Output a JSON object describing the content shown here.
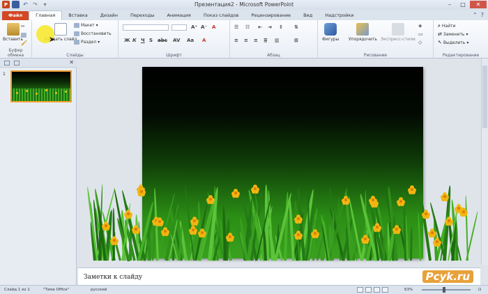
{
  "window": {
    "title": "Презентация2 - Microsoft PowerPoint",
    "app_icon_letter": "P"
  },
  "tabs": [
    {
      "label": "Файл"
    },
    {
      "label": "Главная"
    },
    {
      "label": "Вставка"
    },
    {
      "label": "Дизайн"
    },
    {
      "label": "Переходы"
    },
    {
      "label": "Анимация"
    },
    {
      "label": "Показ слайдов"
    },
    {
      "label": "Рецензирование"
    },
    {
      "label": "Вид"
    },
    {
      "label": "Надстройки"
    }
  ],
  "ribbon": {
    "clipboard": {
      "label": "Буфер обмена",
      "paste": "Вставить"
    },
    "slides": {
      "label": "Слайды",
      "new_slide": "Создать слайд",
      "layout": "Макет",
      "reset": "Восстановить",
      "section": "Раздел"
    },
    "font": {
      "label": "Шрифт"
    },
    "paragraph": {
      "label": "Абзац"
    },
    "drawing": {
      "label": "Рисование",
      "shapes": "Фигуры",
      "arrange": "Упорядочить",
      "quick_styles": "Экспресс-стили"
    },
    "editing": {
      "label": "Редактирование",
      "find": "Найти",
      "replace": "Заменить",
      "select": "Выделить"
    }
  },
  "slides_pane": {
    "slide_number": "1"
  },
  "notes": {
    "placeholder": "Заметки к слайду"
  },
  "watermark": "Pcyk.ru",
  "status": {
    "slide_info": "Слайд 1 из 1",
    "theme": "\"Тема Office\"",
    "language": "русский",
    "zoom": "63%"
  },
  "colors": {
    "file_tab": "#d24726",
    "accent_blue": "#2c5aa0",
    "slide_grass": "#3aa11f",
    "flower": "#f1b50f"
  }
}
